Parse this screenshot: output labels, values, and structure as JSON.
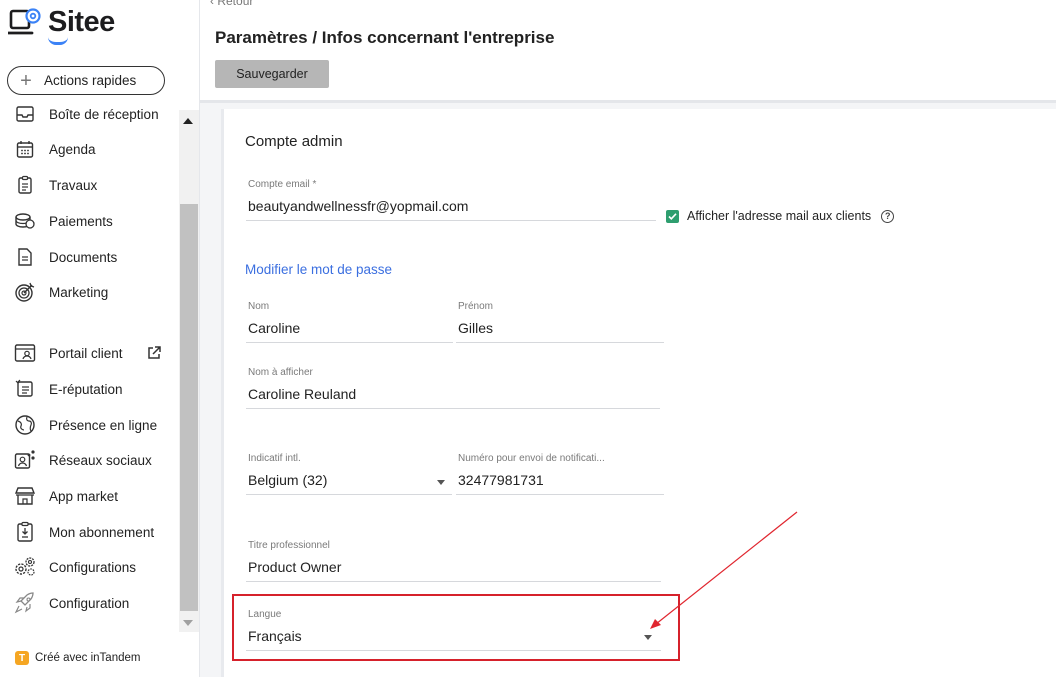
{
  "brand": {
    "name": "Sitee",
    "accent": "#3b82f6"
  },
  "sidebar": {
    "quick_actions": "Actions rapides",
    "items": [
      {
        "label": "Boîte de réception",
        "icon": "inbox-icon"
      },
      {
        "label": "Agenda",
        "icon": "calendar-icon"
      },
      {
        "label": "Travaux",
        "icon": "clipboard-list-icon"
      },
      {
        "label": "Paiements",
        "icon": "coins-icon"
      },
      {
        "label": "Documents",
        "icon": "document-icon"
      },
      {
        "label": "Marketing",
        "icon": "target-icon"
      },
      {
        "label": "Portail client",
        "icon": "browser-user-icon"
      },
      {
        "label": "E-réputation",
        "icon": "review-list-icon"
      },
      {
        "label": "Présence en ligne",
        "icon": "globe-icon"
      },
      {
        "label": "Réseaux sociaux",
        "icon": "social-share-icon"
      },
      {
        "label": "App market",
        "icon": "store-icon"
      },
      {
        "label": "Mon abonnement",
        "icon": "subscription-icon"
      },
      {
        "label": "Configurations",
        "icon": "gears-icon"
      },
      {
        "label": "Configuration",
        "icon": "rocket-icon"
      }
    ],
    "made_with": "Créé avec inTandem"
  },
  "header": {
    "back": "Retour",
    "title": "Paramètres / Infos concernant l'entreprise",
    "save": "Sauvegarder"
  },
  "form": {
    "section_title": "Compte admin",
    "email": {
      "label": "Compte email *",
      "value": "beautyandwellnessfr@yopmail.com"
    },
    "show_email": {
      "label": "Afficher l'adresse mail aux clients",
      "checked": true
    },
    "change_password": "Modifier le mot de passe",
    "last_name": {
      "label": "Nom",
      "value": "Caroline"
    },
    "first_name": {
      "label": "Prénom",
      "value": "Gilles"
    },
    "display_name": {
      "label": "Nom à afficher",
      "value": "Caroline Reuland"
    },
    "dial_code": {
      "label": "Indicatif intl.",
      "value": "Belgium (32)"
    },
    "phone": {
      "label": "Numéro pour envoi de notificati...",
      "value": "32477981731"
    },
    "job_title": {
      "label": "Titre professionnel",
      "value": "Product Owner"
    },
    "language": {
      "label": "Langue",
      "value": "Français"
    }
  },
  "colors": {
    "annotation": "#d6212b",
    "checkbox": "#2e9e6f",
    "link": "#3b6fe0"
  }
}
